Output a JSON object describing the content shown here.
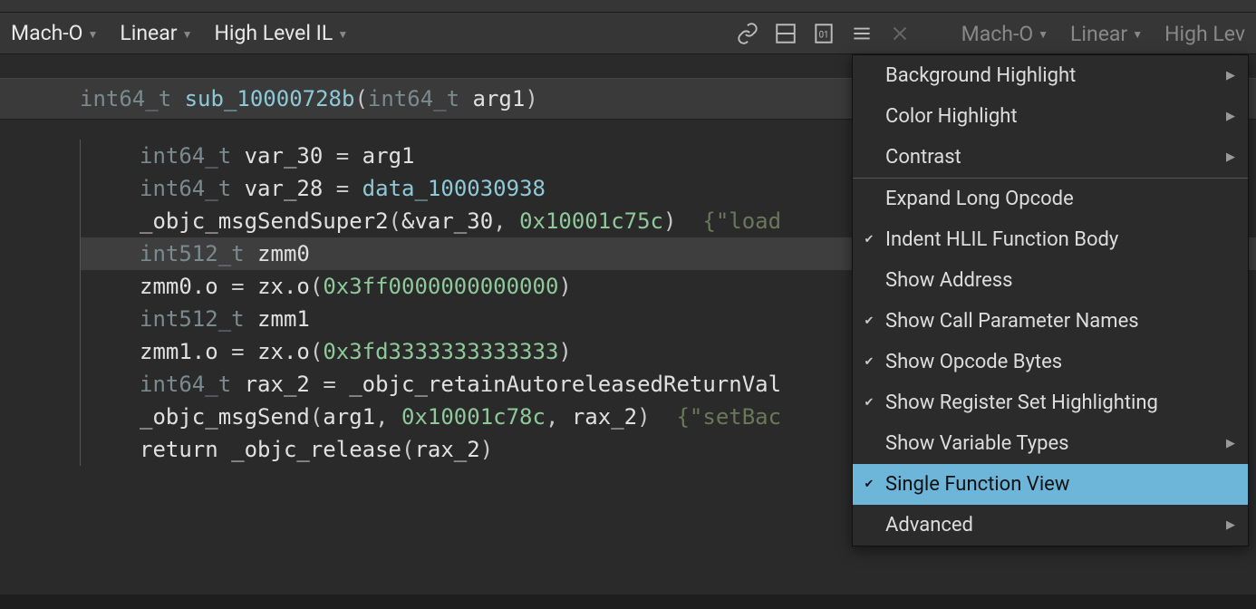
{
  "toolbar": {
    "left_pane": {
      "format": "Mach-O",
      "view": "Linear",
      "il": "High Level IL"
    },
    "right_pane": {
      "format": "Mach-O",
      "view": "Linear",
      "il_fragment": "High Lev"
    }
  },
  "func_header": {
    "ret_type": "int64_t",
    "name": "sub_10000728b",
    "arg_type": "int64_t",
    "arg_name": "arg1"
  },
  "code": {
    "l1_type": "int64_t",
    "l1_var": "var_30",
    "l1_rhs": "arg1",
    "l2_type": "int64_t",
    "l2_var": "var_28",
    "l2_rhs": "data_100030938",
    "l3_call": "_objc_msgSendSuper2",
    "l3_arg1": "&var_30",
    "l3_arg2": "0x10001c75c",
    "l3_comment": "{\"load",
    "l4_type": "int512_t",
    "l4_var": "zmm0",
    "l5_lhs": "zmm0",
    "l5_field": ".o",
    "l5_call": "zx.o",
    "l5_arg": "0x3ff0000000000000",
    "l6_type": "int512_t",
    "l6_var": "zmm1",
    "l7_lhs": "zmm1",
    "l7_field": ".o",
    "l7_call": "zx.o",
    "l7_arg": "0x3fd3333333333333",
    "l8_type": "int64_t",
    "l8_var": "rax_2",
    "l8_rhs": "_objc_retainAutoreleasedReturnVal",
    "l9_call": "_objc_msgSend",
    "l9_arg1": "arg1",
    "l9_arg2": "0x10001c78c",
    "l9_arg3": "rax_2",
    "l9_comment": "{\"setBac",
    "l10_kw": "return",
    "l10_call": "_objc_release",
    "l10_arg": "rax_2"
  },
  "menu": {
    "items": [
      {
        "label": "Background Highlight",
        "checked": false,
        "submenu": true
      },
      {
        "label": "Color Highlight",
        "checked": false,
        "submenu": true
      },
      {
        "label": "Contrast",
        "checked": false,
        "submenu": true
      }
    ],
    "items2": [
      {
        "label": "Expand Long Opcode",
        "checked": false,
        "submenu": false
      },
      {
        "label": "Indent HLIL Function Body",
        "checked": true,
        "submenu": false
      },
      {
        "label": "Show Address",
        "checked": false,
        "submenu": false
      },
      {
        "label": "Show Call Parameter Names",
        "checked": true,
        "submenu": false
      },
      {
        "label": "Show Opcode Bytes",
        "checked": true,
        "submenu": false
      },
      {
        "label": "Show Register Set Highlighting",
        "checked": true,
        "submenu": false
      },
      {
        "label": "Show Variable Types",
        "checked": false,
        "submenu": true
      },
      {
        "label": "Single Function View",
        "checked": true,
        "submenu": false,
        "hover": true
      },
      {
        "label": "Advanced",
        "checked": false,
        "submenu": true
      }
    ]
  }
}
